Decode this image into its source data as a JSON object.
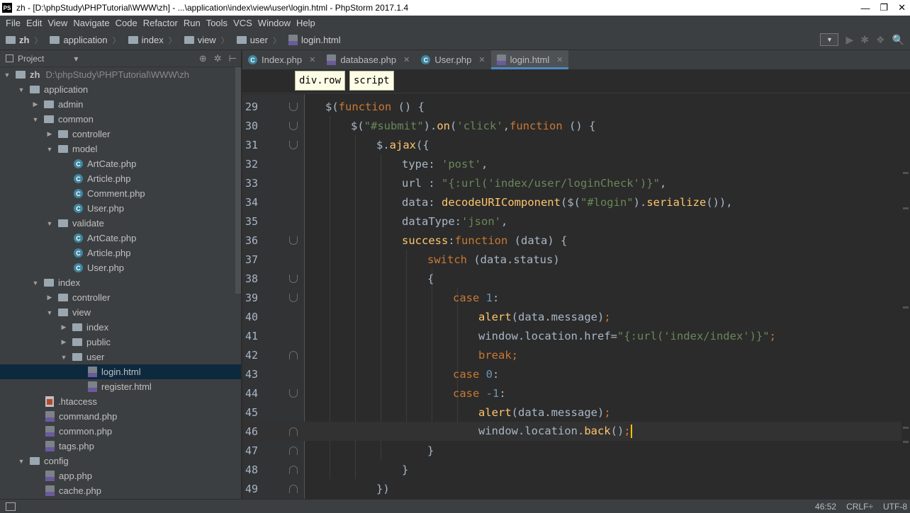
{
  "window": {
    "title": "zh - [D:\\phpStudy\\PHPTutorial\\WWW\\zh] - ...\\application\\index\\view\\user\\login.html - PhpStorm 2017.1.4",
    "app_logo": "PS",
    "controls": {
      "minimize": "—",
      "maximize": "❐",
      "close": "✕"
    }
  },
  "menu": [
    "File",
    "Edit",
    "View",
    "Navigate",
    "Code",
    "Refactor",
    "Run",
    "Tools",
    "VCS",
    "Window",
    "Help"
  ],
  "breadcrumb": [
    "zh",
    "application",
    "index",
    "view",
    "user",
    "login.html"
  ],
  "navbar_tools": {
    "dropdown": "▼",
    "run": "▶",
    "debug": "✱",
    "coverage": "❖",
    "search": "🔍"
  },
  "project_panel": {
    "title": "Project",
    "dropdown": "▾",
    "tools": [
      "⊕",
      "✲",
      "⊢"
    ],
    "tree": [
      {
        "label": "zh",
        "path": "D:\\phpStudy\\PHPTutorial\\WWW\\zh",
        "indent": 0,
        "arrow": "▼",
        "icon": "folder-icon",
        "bold": true
      },
      {
        "label": "application",
        "indent": 1,
        "arrow": "▼",
        "icon": "folder-icon"
      },
      {
        "label": "admin",
        "indent": 2,
        "arrow": "▶",
        "icon": "folder-icon"
      },
      {
        "label": "common",
        "indent": 2,
        "arrow": "▼",
        "icon": "folder-icon"
      },
      {
        "label": "controller",
        "indent": 3,
        "arrow": "▶",
        "icon": "folder-icon"
      },
      {
        "label": "model",
        "indent": 3,
        "arrow": "▼",
        "icon": "folder-icon"
      },
      {
        "label": "ArtCate.php",
        "indent": 5,
        "arrow": "",
        "icon": "php-class-icon"
      },
      {
        "label": "Article.php",
        "indent": 5,
        "arrow": "",
        "icon": "php-class-icon"
      },
      {
        "label": "Comment.php",
        "indent": 5,
        "arrow": "",
        "icon": "php-class-icon"
      },
      {
        "label": "User.php",
        "indent": 5,
        "arrow": "",
        "icon": "php-class-icon"
      },
      {
        "label": "validate",
        "indent": 3,
        "arrow": "▼",
        "icon": "folder-icon"
      },
      {
        "label": "ArtCate.php",
        "indent": 5,
        "arrow": "",
        "icon": "php-class-icon"
      },
      {
        "label": "Article.php",
        "indent": 5,
        "arrow": "",
        "icon": "php-class-icon"
      },
      {
        "label": "User.php",
        "indent": 5,
        "arrow": "",
        "icon": "php-class-icon"
      },
      {
        "label": "index",
        "indent": 2,
        "arrow": "▼",
        "icon": "folder-icon"
      },
      {
        "label": "controller",
        "indent": 3,
        "arrow": "▶",
        "icon": "folder-icon"
      },
      {
        "label": "view",
        "indent": 3,
        "arrow": "▼",
        "icon": "folder-icon"
      },
      {
        "label": "index",
        "indent": 4,
        "arrow": "▶",
        "icon": "folder-icon"
      },
      {
        "label": "public",
        "indent": 4,
        "arrow": "▶",
        "icon": "folder-icon"
      },
      {
        "label": "user",
        "indent": 4,
        "arrow": "▼",
        "icon": "folder-icon"
      },
      {
        "label": "login.html",
        "indent": 6,
        "arrow": "",
        "icon": "php-file-icon",
        "selected": true
      },
      {
        "label": "register.html",
        "indent": 6,
        "arrow": "",
        "icon": "php-file-icon"
      },
      {
        "label": ".htaccess",
        "indent": 3,
        "arrow": "",
        "icon": "htaccess-file-icon"
      },
      {
        "label": "command.php",
        "indent": 3,
        "arrow": "",
        "icon": "php-file-icon"
      },
      {
        "label": "common.php",
        "indent": 3,
        "arrow": "",
        "icon": "php-file-icon"
      },
      {
        "label": "tags.php",
        "indent": 3,
        "arrow": "",
        "icon": "php-file-icon"
      },
      {
        "label": "config",
        "indent": 1,
        "arrow": "▼",
        "icon": "folder-icon"
      },
      {
        "label": "app.php",
        "indent": 3,
        "arrow": "",
        "icon": "php-file-icon"
      },
      {
        "label": "cache.php",
        "indent": 3,
        "arrow": "",
        "icon": "php-file-icon"
      }
    ]
  },
  "tabs": [
    {
      "label": "Index.php",
      "icon": "php-class-icon",
      "close": "✕",
      "active": false
    },
    {
      "label": "database.php",
      "icon": "php-file-icon",
      "close": "✕",
      "active": false
    },
    {
      "label": "User.php",
      "icon": "php-class-icon",
      "close": "✕",
      "active": false
    },
    {
      "label": "login.html",
      "icon": "php-file-icon",
      "close": "✕",
      "active": true
    }
  ],
  "editor_breadcrumb": [
    "div.row",
    "script"
  ],
  "code_lines": [
    {
      "num": "29",
      "indent": 0,
      "fold": "open",
      "tokens": [
        [
          "p",
          "$("
        ],
        [
          "k",
          "function"
        ],
        [
          "p",
          " () {"
        ]
      ]
    },
    {
      "num": "30",
      "indent": 1,
      "fold": "open",
      "tokens": [
        [
          "p",
          "$("
        ],
        [
          "s",
          "\"#submit\""
        ],
        [
          "p",
          ")."
        ],
        [
          "f",
          "on"
        ],
        [
          "p",
          "("
        ],
        [
          "s",
          "'click'"
        ],
        [
          "p",
          ","
        ],
        [
          "k",
          "function"
        ],
        [
          "p",
          " () {"
        ]
      ]
    },
    {
      "num": "31",
      "indent": 2,
      "fold": "open",
      "tokens": [
        [
          "p",
          "$."
        ],
        [
          "f",
          "ajax"
        ],
        [
          "p",
          "({"
        ]
      ]
    },
    {
      "num": "32",
      "indent": 3,
      "fold": "",
      "tokens": [
        [
          "p",
          "type: "
        ],
        [
          "s",
          "'post'"
        ],
        [
          "p",
          ","
        ]
      ]
    },
    {
      "num": "33",
      "indent": 3,
      "fold": "",
      "tokens": [
        [
          "p",
          "url : "
        ],
        [
          "s",
          "\"{:url('index/user/loginCheck')}\""
        ],
        [
          "p",
          ","
        ]
      ]
    },
    {
      "num": "34",
      "indent": 3,
      "fold": "",
      "tokens": [
        [
          "p",
          "data: "
        ],
        [
          "f",
          "decodeURIComponent"
        ],
        [
          "p",
          "($("
        ],
        [
          "s",
          "\"#login\""
        ],
        [
          "p",
          ")."
        ],
        [
          "f",
          "serialize"
        ],
        [
          "p",
          "()),"
        ]
      ]
    },
    {
      "num": "35",
      "indent": 3,
      "fold": "",
      "tokens": [
        [
          "p",
          "dataType:"
        ],
        [
          "s",
          "'json'"
        ],
        [
          "p",
          ","
        ]
      ]
    },
    {
      "num": "36",
      "indent": 3,
      "fold": "open",
      "tokens": [
        [
          "f",
          "success"
        ],
        [
          "p",
          ":"
        ],
        [
          "k",
          "function"
        ],
        [
          "p",
          " (data) {"
        ]
      ]
    },
    {
      "num": "37",
      "indent": 4,
      "fold": "",
      "tokens": [
        [
          "k",
          "switch"
        ],
        [
          "p",
          " (data.status)"
        ]
      ]
    },
    {
      "num": "38",
      "indent": 4,
      "fold": "open",
      "tokens": [
        [
          "p",
          "{"
        ]
      ]
    },
    {
      "num": "39",
      "indent": 5,
      "fold": "open",
      "tokens": [
        [
          "k",
          "case "
        ],
        [
          "n",
          "1"
        ],
        [
          "p",
          ":"
        ]
      ]
    },
    {
      "num": "40",
      "indent": 6,
      "fold": "",
      "tokens": [
        [
          "f",
          "alert"
        ],
        [
          "p",
          "(data.message)"
        ],
        [
          "k",
          ";"
        ]
      ]
    },
    {
      "num": "41",
      "indent": 6,
      "fold": "",
      "tokens": [
        [
          "p",
          "window.location.href="
        ],
        [
          "s",
          "\"{:url('index/index')}\""
        ],
        [
          "k",
          ";"
        ]
      ]
    },
    {
      "num": "42",
      "indent": 6,
      "fold": "close",
      "tokens": [
        [
          "k",
          "break;"
        ]
      ]
    },
    {
      "num": "43",
      "indent": 5,
      "fold": "",
      "tokens": [
        [
          "k",
          "case "
        ],
        [
          "n",
          "0"
        ],
        [
          "p",
          ":"
        ]
      ]
    },
    {
      "num": "44",
      "indent": 5,
      "fold": "open",
      "tokens": [
        [
          "k",
          "case "
        ],
        [
          "n",
          "-1"
        ],
        [
          "p",
          ":"
        ]
      ]
    },
    {
      "num": "45",
      "indent": 6,
      "fold": "",
      "tokens": [
        [
          "f",
          "alert"
        ],
        [
          "p",
          "(data.message)"
        ],
        [
          "k",
          ";"
        ]
      ]
    },
    {
      "num": "46",
      "indent": 6,
      "fold": "close",
      "caret": true,
      "tokens": [
        [
          "p",
          "window.location."
        ],
        [
          "f",
          "back"
        ],
        [
          "p",
          "()"
        ],
        [
          "k",
          ";"
        ]
      ]
    },
    {
      "num": "47",
      "indent": 4,
      "fold": "close",
      "tokens": [
        [
          "p",
          "}"
        ]
      ]
    },
    {
      "num": "48",
      "indent": 3,
      "fold": "close",
      "tokens": [
        [
          "p",
          "}"
        ]
      ]
    },
    {
      "num": "49",
      "indent": 2,
      "fold": "close",
      "tokens": [
        [
          "p",
          "})"
        ]
      ]
    }
  ],
  "status": {
    "position": "46:52",
    "line_separator": "CRLF÷",
    "encoding": "UTF-8"
  },
  "colors": {
    "keyword": "#cc7832",
    "string": "#6a8759",
    "function": "#ffc66d",
    "number": "#6897bb",
    "caret": "#ffc000",
    "selection": "#0d293e"
  }
}
